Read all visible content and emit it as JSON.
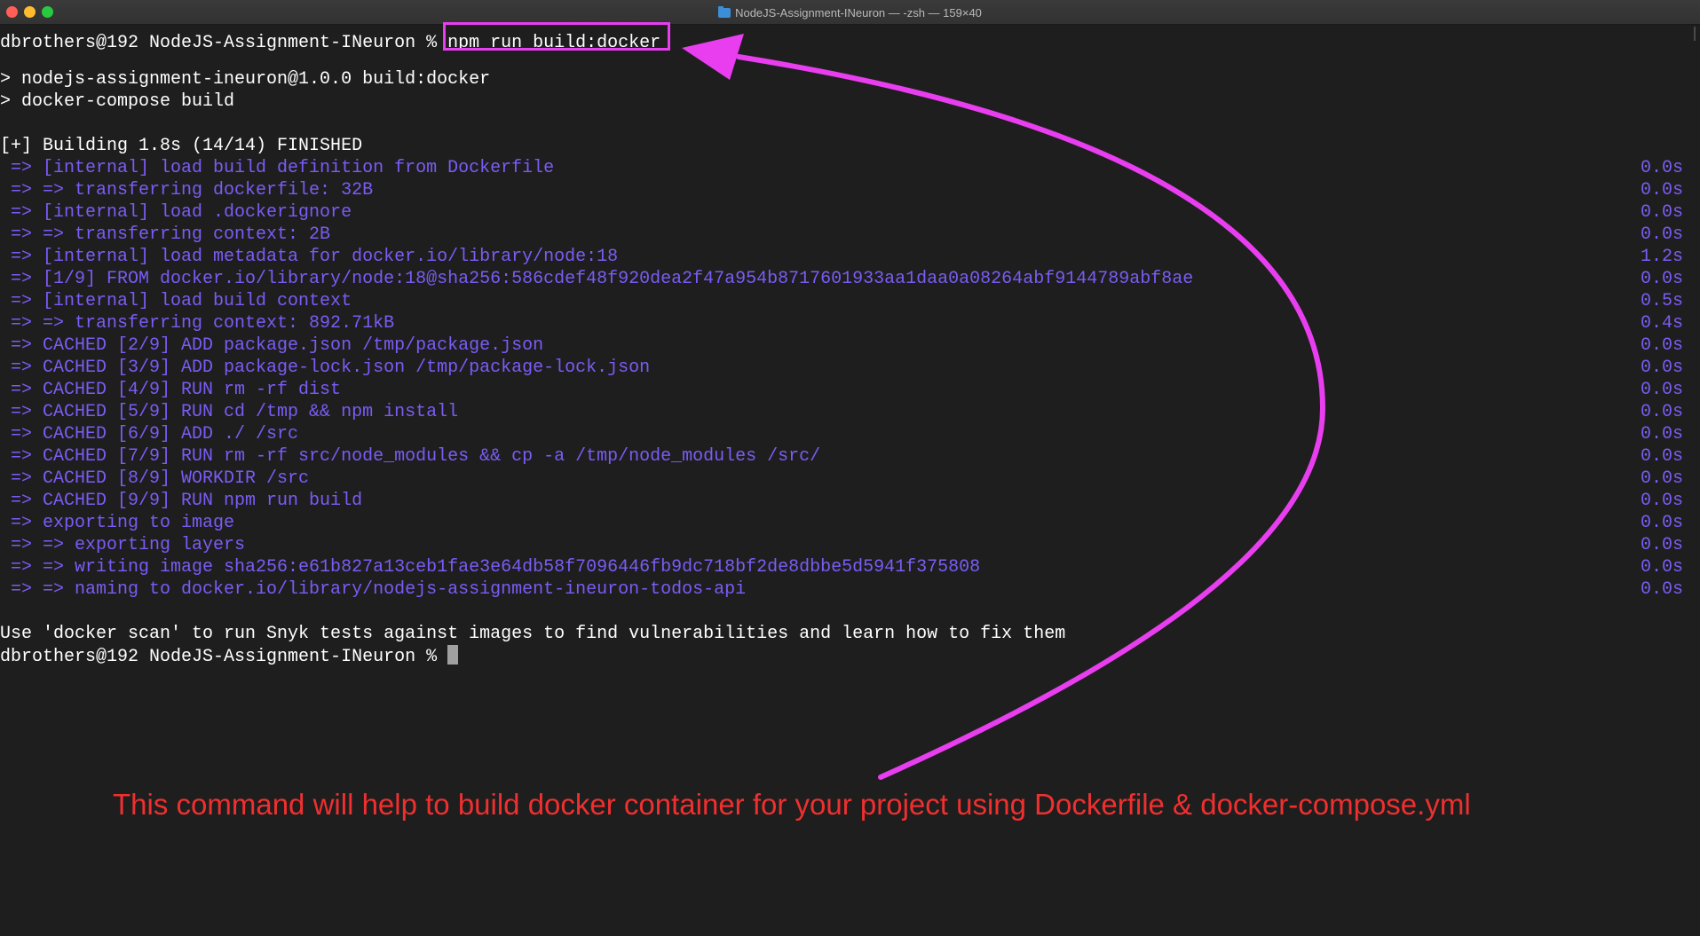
{
  "window": {
    "title": "NodeJS-Assignment-INeuron — -zsh — 159×40",
    "folder_icon": "folder-icon",
    "colors": {
      "close": "#ff5f57",
      "minimize": "#febc2e",
      "maximize": "#28c840",
      "output_text": "#7b5cf5",
      "highlight": "#e83ef0",
      "annotation": "#f02f2f"
    }
  },
  "terminal": {
    "prompt": "dbrothers@192 NodeJS-Assignment-INeuron % ",
    "command": "npm run build:docker",
    "script_line": "> nodejs-assignment-ineuron@1.0.0 build:docker",
    "exec_line": "> docker-compose build",
    "build_header": "[+] Building 1.8s (14/14) FINISHED",
    "build_steps": [
      {
        "text": " => [internal] load build definition from Dockerfile",
        "time": "0.0s"
      },
      {
        "text": " => => transferring dockerfile: 32B",
        "time": "0.0s"
      },
      {
        "text": " => [internal] load .dockerignore",
        "time": "0.0s"
      },
      {
        "text": " => => transferring context: 2B",
        "time": "0.0s"
      },
      {
        "text": " => [internal] load metadata for docker.io/library/node:18",
        "time": "1.2s"
      },
      {
        "text": " => [1/9] FROM docker.io/library/node:18@sha256:586cdef48f920dea2f47a954b8717601933aa1daa0a08264abf9144789abf8ae",
        "time": "0.0s"
      },
      {
        "text": " => [internal] load build context",
        "time": "0.5s"
      },
      {
        "text": " => => transferring context: 892.71kB",
        "time": "0.4s"
      },
      {
        "text": " => CACHED [2/9] ADD package.json /tmp/package.json",
        "time": "0.0s"
      },
      {
        "text": " => CACHED [3/9] ADD package-lock.json /tmp/package-lock.json",
        "time": "0.0s"
      },
      {
        "text": " => CACHED [4/9] RUN rm -rf dist",
        "time": "0.0s"
      },
      {
        "text": " => CACHED [5/9] RUN cd /tmp && npm install",
        "time": "0.0s"
      },
      {
        "text": " => CACHED [6/9] ADD ./ /src",
        "time": "0.0s"
      },
      {
        "text": " => CACHED [7/9] RUN rm -rf src/node_modules && cp -a /tmp/node_modules /src/",
        "time": "0.0s"
      },
      {
        "text": " => CACHED [8/9] WORKDIR /src",
        "time": "0.0s"
      },
      {
        "text": " => CACHED [9/9] RUN npm run build",
        "time": "0.0s"
      },
      {
        "text": " => exporting to image",
        "time": "0.0s"
      },
      {
        "text": " => => exporting layers",
        "time": "0.0s"
      },
      {
        "text": " => => writing image sha256:e61b827a13ceb1fae3e64db58f7096446fb9dc718bf2de8dbbe5d5941f375808",
        "time": "0.0s"
      },
      {
        "text": " => => naming to docker.io/library/nodejs-assignment-ineuron-todos-api",
        "time": "0.0s"
      }
    ],
    "scan_hint": "Use 'docker scan' to run Snyk tests against images to find vulnerabilities and learn how to fix them",
    "final_prompt": "dbrothers@192 NodeJS-Assignment-INeuron % "
  },
  "annotation": {
    "text": "This command will help to build docker container for your project using Dockerfile & docker-compose.yml"
  }
}
